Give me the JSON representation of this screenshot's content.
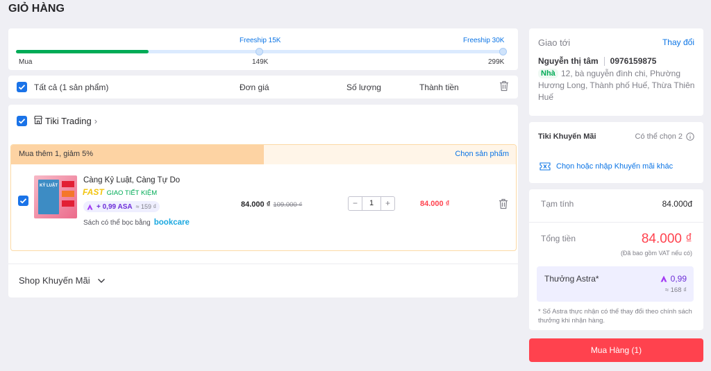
{
  "page": {
    "title": "GIỎ HÀNG"
  },
  "progress": {
    "milestones": [
      {
        "top": "",
        "bottom": "Mua"
      },
      {
        "top": "Freeship 15K",
        "bottom": "149K"
      },
      {
        "top": "Freeship 30K",
        "bottom": "299K"
      }
    ],
    "fill_fraction": 0.27
  },
  "header_row": {
    "select_all": "Tất cả (1 sản phẩm)",
    "unit_price": "Đơn giá",
    "quantity": "Số lượng",
    "total": "Thành tiền"
  },
  "seller": {
    "name": "Tiki Trading",
    "chevron": "›"
  },
  "promo_bar": {
    "text": "Mua thêm 1, giảm 5%",
    "link": "Chọn sản phẩm"
  },
  "item": {
    "name": "Càng Kỷ Luật, Càng Tự Do",
    "fast": "FAST",
    "shipping": "GIAO TIẾT KIỆM",
    "astra": "+ 0,99 ASA",
    "astra_approx": "≈ 159 ₫",
    "note": "Sách có thể bọc bằng",
    "bookcare": "bookcare",
    "price": "84.000 ₫",
    "old_price": "109.000 ₫",
    "qty": "1",
    "minus": "−",
    "plus": "+",
    "line_total": "84.000 ₫",
    "cover_text": "KỶ LUẬT"
  },
  "shop_promo": {
    "label": "Shop Khuyến Mãi"
  },
  "delivery": {
    "label": "Giao tới",
    "change": "Thay đổi",
    "name": "Nguyễn thị tâm",
    "phone": "0976159875",
    "tag": "Nhà",
    "address": "12, bà nguyễn đình chi, Phường Hương Long, Thành phố Huế, Thừa Thiên Huế"
  },
  "tiki_promo": {
    "title": "Tiki Khuyến Mãi",
    "choose": "Có thể chọn 2",
    "link": "Chọn hoặc nhập Khuyến mãi khác"
  },
  "summary": {
    "subtotal_label": "Tạm tính",
    "subtotal": "84.000đ",
    "total_label": "Tổng tiền",
    "total": "84.000 ₫",
    "vat": "(Đã bao gồm VAT nếu có)",
    "astra_label": "Thưởng Astra*",
    "astra_value": "0,99",
    "astra_approx": "≈ 168 ₫",
    "note": "* Số Astra thực nhận có thể thay đổi theo chính sách thưởng khi nhận hàng."
  },
  "checkout": {
    "label": "Mua Hàng (1)"
  },
  "colors": {
    "accent": "#0b74e5",
    "progress": "#00ab56",
    "price_red": "#ff424e",
    "checkout": "#ff424e"
  }
}
